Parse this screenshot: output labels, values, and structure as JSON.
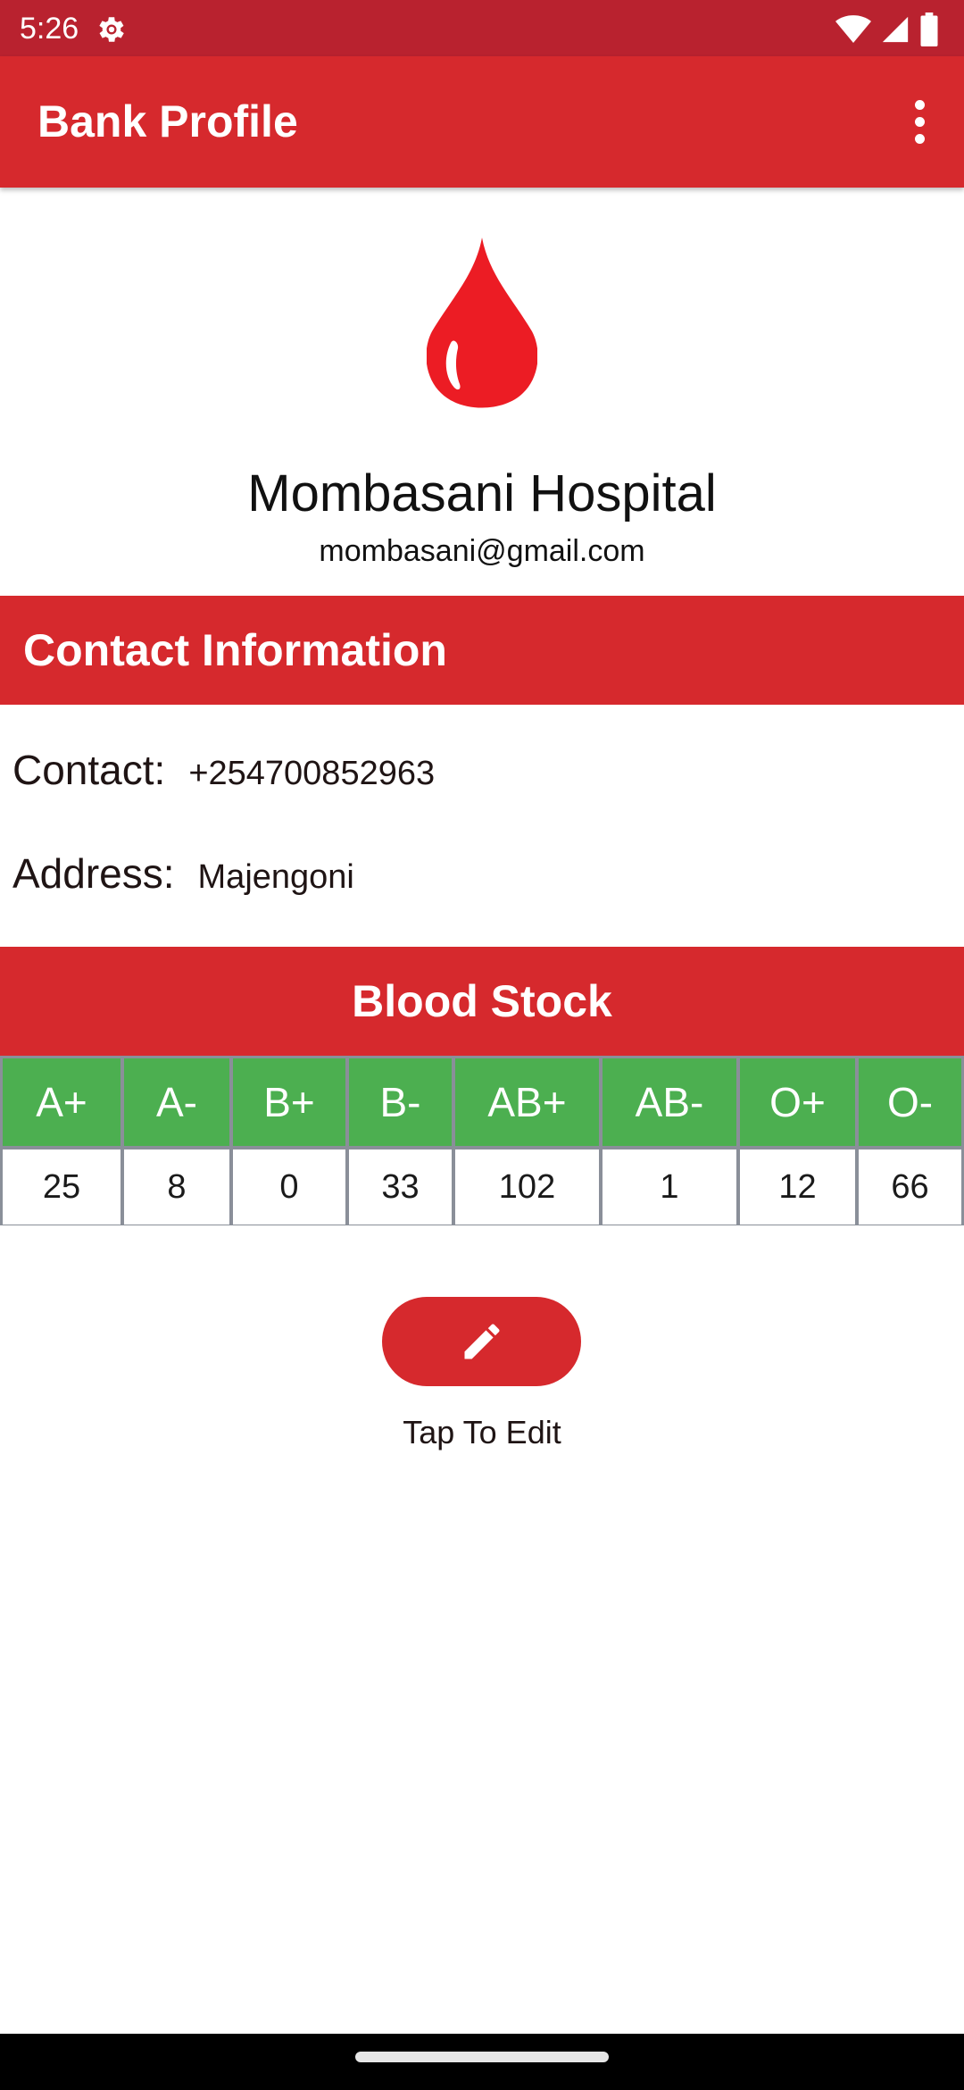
{
  "status_bar": {
    "time": "5:26",
    "icons": [
      "settings-icon",
      "wifi-icon",
      "signal-icon",
      "battery-icon"
    ]
  },
  "app_bar": {
    "title": "Bank Profile",
    "menu_icon": "more-vert-icon"
  },
  "profile": {
    "logo_icon": "blood-drop-icon",
    "name": "Mombasani Hospital",
    "email": "mombasani@gmail.com"
  },
  "contact_section": {
    "header": "Contact Information",
    "contact_label": "Contact:",
    "contact_value": "+254700852963",
    "address_label": "Address:",
    "address_value": "Majengoni"
  },
  "blood_stock": {
    "header": "Blood Stock",
    "items": [
      {
        "type": "A+",
        "count": "25"
      },
      {
        "type": "A-",
        "count": "8"
      },
      {
        "type": "B+",
        "count": "0"
      },
      {
        "type": "B-",
        "count": "33"
      },
      {
        "type": "AB+",
        "count": "102"
      },
      {
        "type": "AB-",
        "count": "1"
      },
      {
        "type": "O+",
        "count": "12"
      },
      {
        "type": "O-",
        "count": "66"
      }
    ]
  },
  "edit": {
    "icon": "pencil-icon",
    "caption": "Tap To Edit"
  },
  "colors": {
    "status_bar": "#b9222f",
    "primary": "#d6292d",
    "table_header": "#4caf50",
    "table_border": "#8a8f99",
    "blood_drop": "#ec1c24"
  }
}
